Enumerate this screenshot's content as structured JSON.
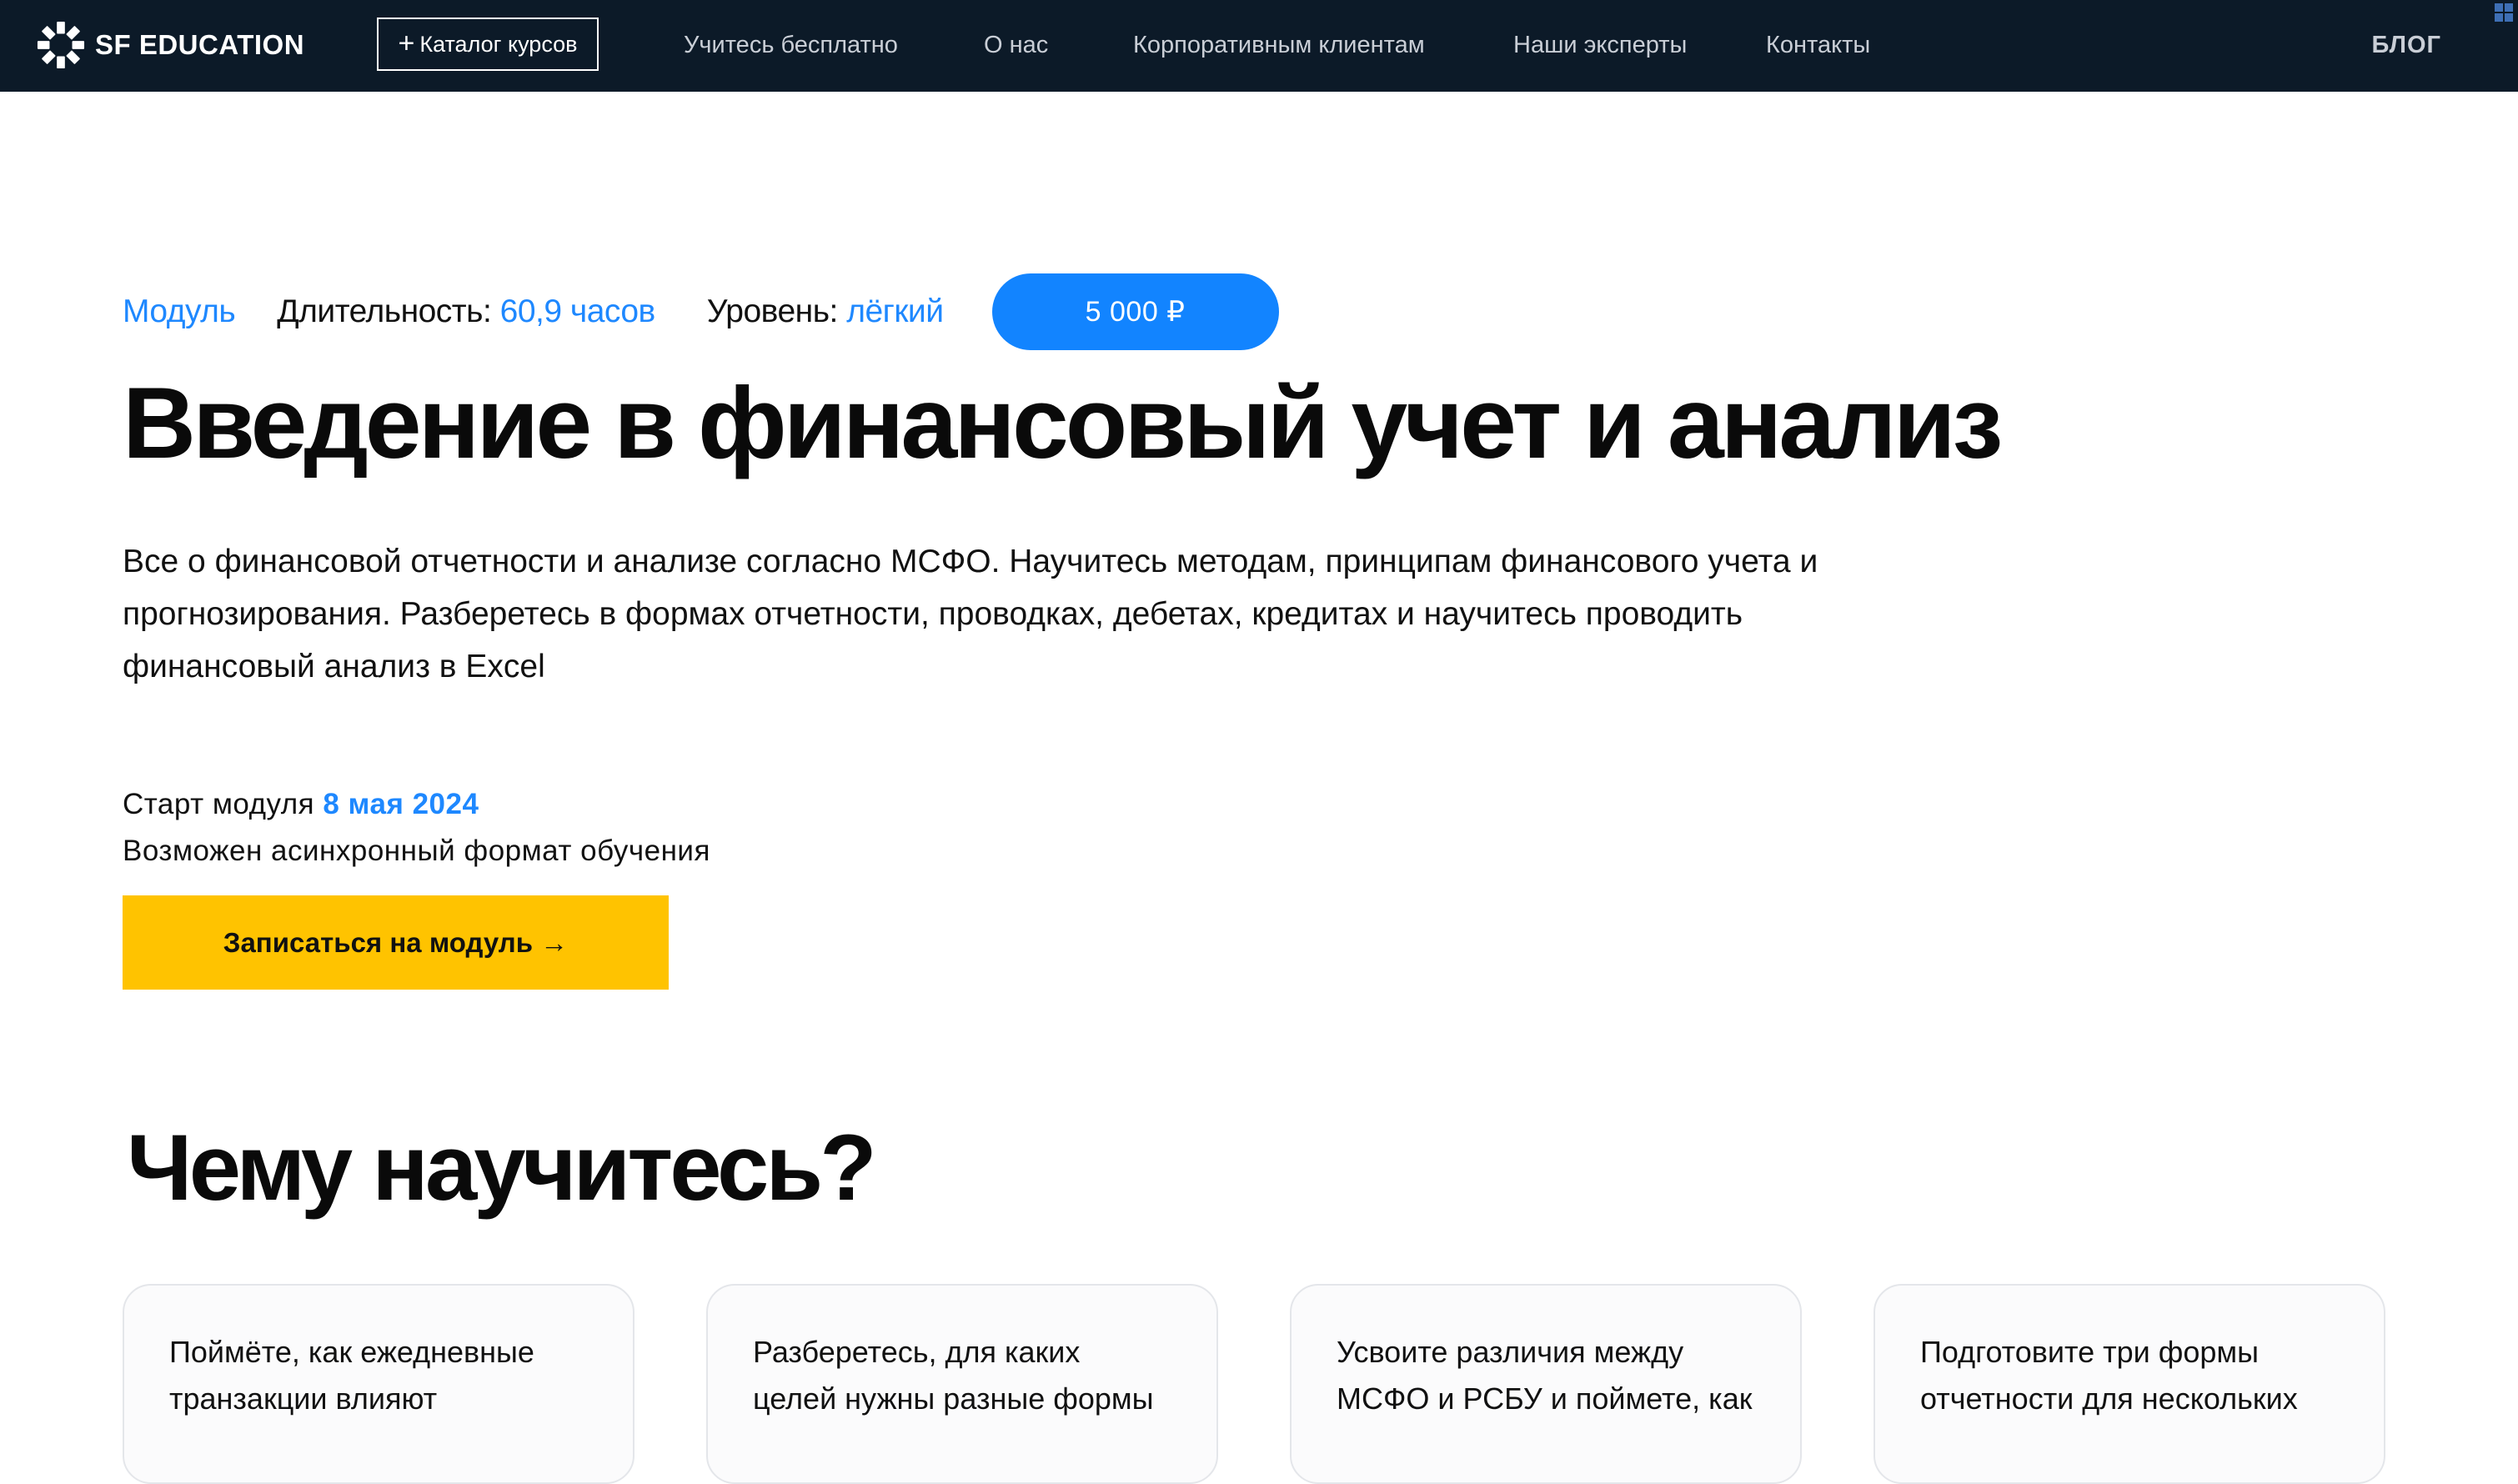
{
  "header": {
    "logo_text": "SF EDUCATION",
    "catalog_label": "Каталог курсов",
    "nav": [
      "Учитесь бесплатно",
      "О нас",
      "Корпоративным клиентам",
      "Наши эксперты",
      "Контакты"
    ],
    "blog_label": "БЛОГ"
  },
  "course": {
    "type": "Модуль",
    "duration_label": "Длительность:",
    "duration_value": "60,9 часов",
    "level_label": "Уровень:",
    "level_value": "лёгкий",
    "price": "5 000 ₽",
    "title": "Введение в финансовый учет и анализ",
    "description": "Все о финансовой отчетности и анализе согласно МСФО. Научитесь методам, принципам финансового учета и прогнозирования. Разберетесь в формах отчетности, проводках, дебетах, кредитах и научитесь проводить финансовый анализ в Excel",
    "start_label": "Старт модуля",
    "start_date": "8 мая 2024",
    "async_note": "Возможен асинхронный формат обучения",
    "enroll_label": "Записаться на модуль →"
  },
  "learn": {
    "title": "Чему научитесь?",
    "cards": [
      "Поймёте, как ежедневные транзакции влияют",
      "Разберетесь, для каких целей нужны разные формы",
      "Усвоите различия между МСФО и РСБУ и поймете, как",
      "Подготовите три формы отчетности для нескольких"
    ]
  },
  "colors": {
    "header_bg": "#0c1a28",
    "accent_blue": "#1e88ff",
    "cta_yellow": "#ffc300"
  }
}
